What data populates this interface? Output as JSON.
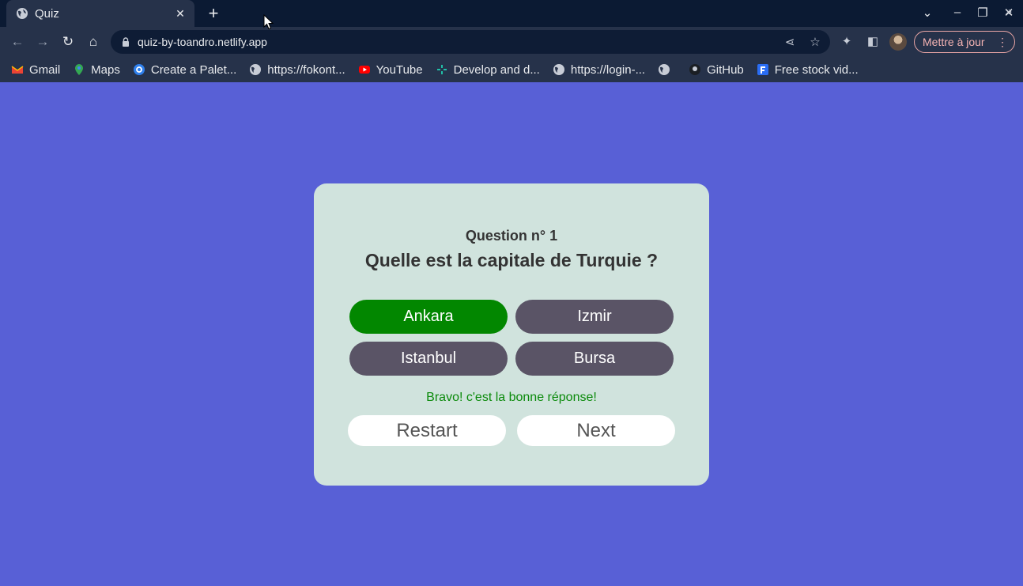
{
  "browser": {
    "tab_title": "Quiz",
    "tab_close": "✕",
    "new_tab": "+",
    "url": "quiz-by-toandro.netlify.app",
    "update_label": "Mettre à jour",
    "bookmarks": [
      {
        "label": "Gmail",
        "icon": "gmail-icon"
      },
      {
        "label": "Maps",
        "icon": "maps-icon"
      },
      {
        "label": "Create a Palet...",
        "icon": "canva-icon"
      },
      {
        "label": "https://fokont...",
        "icon": "globe-icon"
      },
      {
        "label": "YouTube",
        "icon": "youtube-icon"
      },
      {
        "label": "Develop and d...",
        "icon": "dev-icon"
      },
      {
        "label": "https://login-...",
        "icon": "globe-icon"
      },
      {
        "label": "",
        "icon": "globe-icon"
      },
      {
        "label": "GitHub",
        "icon": "github-icon"
      },
      {
        "label": "Free stock vid...",
        "icon": "stock-icon"
      }
    ]
  },
  "quiz": {
    "question_number": "Question n° 1",
    "question": "Quelle est la capitale de Turquie ?",
    "answers": [
      "Ankara",
      "Izmir",
      "Istanbul",
      "Bursa"
    ],
    "correct_answer": "Ankara",
    "feedback": "Bravo! c'est la bonne réponse!",
    "restart_label": "Restart",
    "next_label": "Next"
  },
  "colors": {
    "page_background": "#5860d6",
    "card_background": "#d0e3dd",
    "correct": "#028700",
    "answer_default": "#5a5466",
    "feedback_text": "#0a8a0a"
  }
}
